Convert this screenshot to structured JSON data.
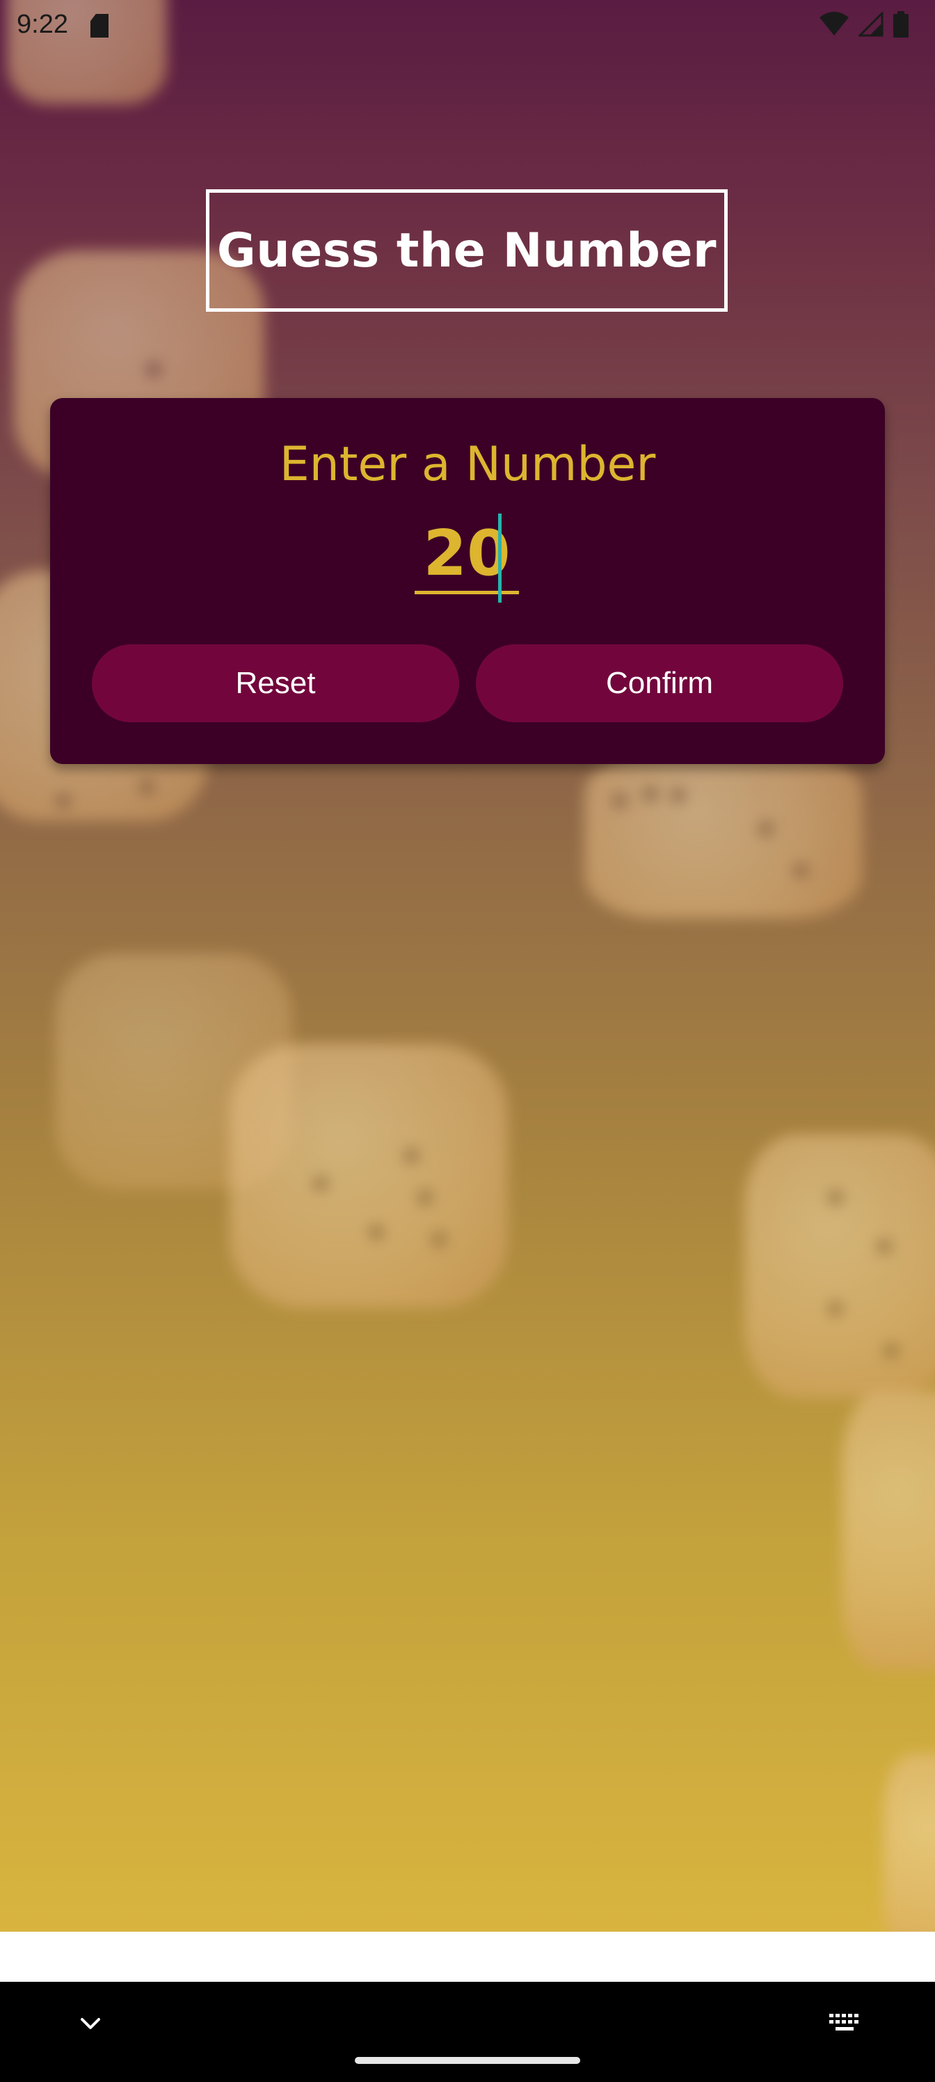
{
  "status_bar": {
    "time": "9:22",
    "icons": [
      "sim-card-icon",
      "wifi-icon",
      "signal-icon",
      "battery-icon"
    ]
  },
  "app": {
    "title": "Guess the Number"
  },
  "card": {
    "heading": "Enter a Number",
    "input_value": "20",
    "reset_label": "Reset",
    "confirm_label": "Confirm"
  },
  "nav_bar": {
    "icons": [
      "chevron-down-icon",
      "keyboard-icon"
    ]
  },
  "colors": {
    "accent": "#ddb52f",
    "card_background": "#3c0026",
    "button": "#72063c",
    "caret": "#27b3b0"
  }
}
